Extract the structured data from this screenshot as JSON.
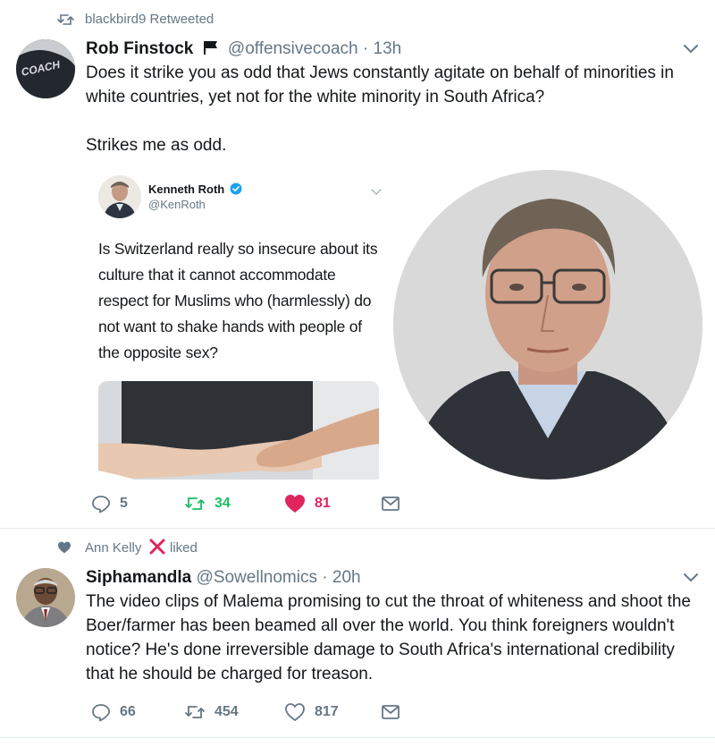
{
  "tweets": [
    {
      "context": {
        "icon": "retweet-icon",
        "text": "blackbird9 Retweeted"
      },
      "author": {
        "name": "Rob Finstock",
        "badge": "flag-icon",
        "handle": "@offensivecoach",
        "time": "· 13h",
        "avatar_text": "COACH"
      },
      "text": "Does it strike you as odd that Jews constantly agitate on behalf of minorities in white countries, yet not for the white minority in South Africa?\n\nStrikes me as odd.",
      "embedded": {
        "name": "Kenneth Roth",
        "verified": true,
        "handle": "@KenRoth",
        "text": "Is Switzerland really so insecure about its culture that it cannot accommodate respect for Muslims who (harmlessly) do not want to shake hands with people of the opposite sex?"
      },
      "actions": {
        "replies": "5",
        "retweets": "34",
        "likes": "81",
        "retweeted": true,
        "liked": true
      }
    },
    {
      "context": {
        "icon": "heart-icon",
        "text": "Ann Kelly",
        "badge": "x-mark",
        "suffix": "liked"
      },
      "author": {
        "name": "Siphamandla",
        "handle": "@Sowellnomics",
        "time": "· 20h"
      },
      "text": "The video clips of Malema promising to cut the throat of whiteness and shoot the Boer/farmer has been beamed all over the world. You think foreigners wouldn't notice? He's done irreversible damage to South Africa's international credibility that he should be charged for treason.",
      "actions": {
        "replies": "66",
        "retweets": "454",
        "likes": "817",
        "retweeted": false,
        "liked": false
      }
    }
  ],
  "colors": {
    "text": "#14171a",
    "muted": "#657786",
    "retweet_green": "#17bf63",
    "like_red": "#e0245e",
    "divider": "#e6ecf0"
  }
}
